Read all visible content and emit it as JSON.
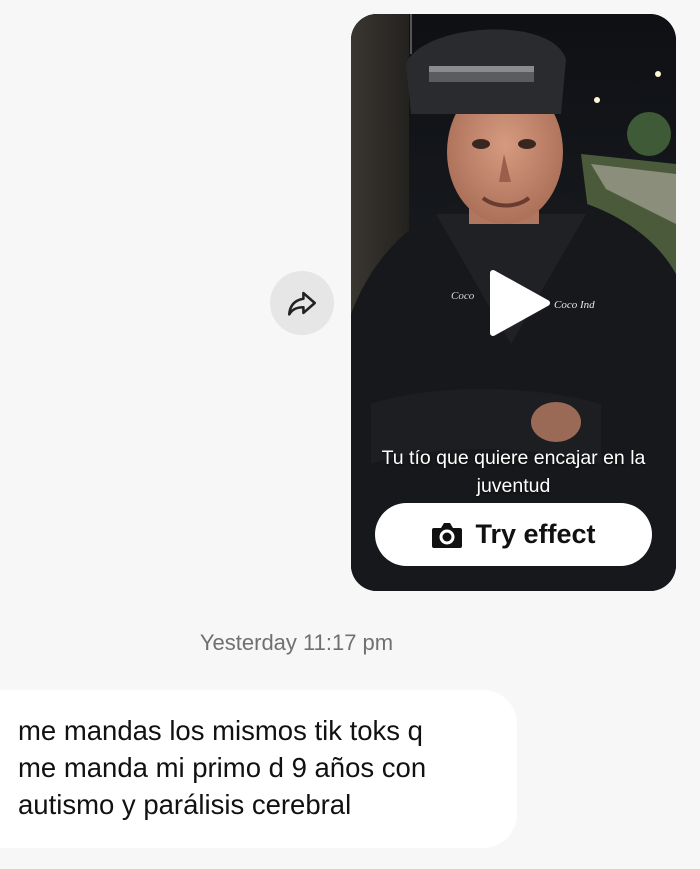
{
  "message_thread": {
    "shared_video": {
      "caption": "Tu tío que quiere encajar en la juventud",
      "jacket_text": "Coco Ind",
      "action_button_label": "Try effect",
      "action_icon": "camera-icon",
      "play_icon": "play-icon",
      "forward_icon": "share-forward-icon"
    },
    "timestamp": "Yesterday 11:17 pm",
    "received_message": {
      "text": "me mandas los mismos tik toks q\nme manda mi primo d 9 años con\nautismo y parálisis cerebral"
    }
  },
  "colors": {
    "background": "#f7f7f7",
    "bubble": "#ffffff",
    "forward_button": "#e6e6e6",
    "timestamp_text": "#707070"
  }
}
